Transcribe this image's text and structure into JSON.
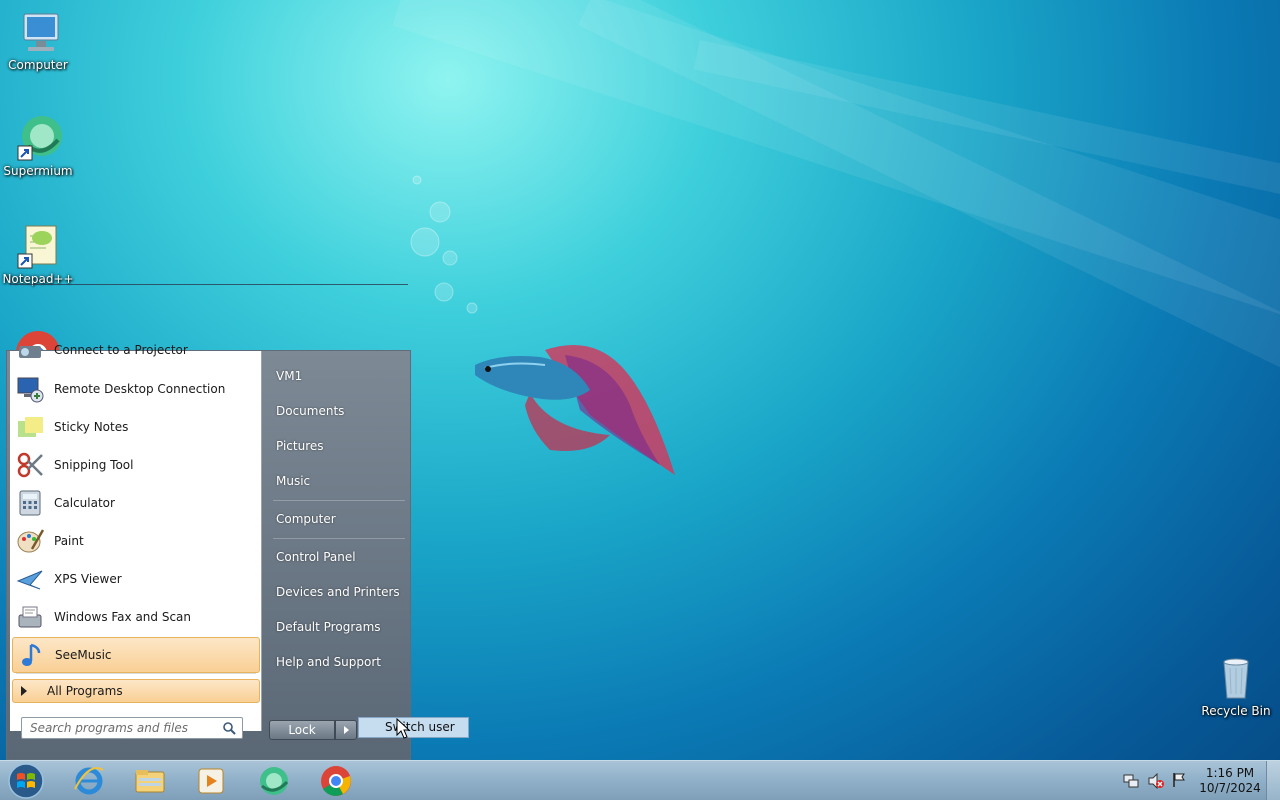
{
  "desktop": {
    "icons": [
      {
        "label": "Computer",
        "icon": "computer-icon"
      },
      {
        "label": "Supermium",
        "icon": "supermium-icon"
      },
      {
        "label": "Notepad++",
        "icon": "notepadplusplus-icon"
      },
      {
        "label": "Recycle Bin",
        "icon": "recycle-bin-icon"
      }
    ]
  },
  "start_menu": {
    "programs": [
      {
        "label": "Connect to a Projector",
        "icon": "projector-icon"
      },
      {
        "label": "Remote Desktop Connection",
        "icon": "remote-desktop-icon"
      },
      {
        "label": "Sticky Notes",
        "icon": "sticky-notes-icon"
      },
      {
        "label": "Snipping Tool",
        "icon": "scissors-icon"
      },
      {
        "label": "Calculator",
        "icon": "calculator-icon"
      },
      {
        "label": "Paint",
        "icon": "paint-palette-icon"
      },
      {
        "label": "XPS Viewer",
        "icon": "xps-viewer-icon"
      },
      {
        "label": "Windows Fax and Scan",
        "icon": "fax-icon"
      },
      {
        "label": "SeeMusic",
        "icon": "music-note-icon"
      }
    ],
    "all_programs": "All Programs",
    "search_placeholder": "Search programs and files",
    "places": [
      "VM1",
      "Documents",
      "Pictures",
      "Music",
      "Computer",
      "Control Panel",
      "Devices and Printers",
      "Default Programs",
      "Help and Support"
    ],
    "lock_label": "Lock",
    "submenu": {
      "switch_user": "Switch user"
    }
  },
  "taskbar": {
    "pinned": [
      {
        "name": "internet-explorer-icon"
      },
      {
        "name": "file-explorer-icon"
      },
      {
        "name": "media-player-icon"
      },
      {
        "name": "supermium-icon"
      },
      {
        "name": "chrome-icon"
      }
    ],
    "clock": {
      "time": "1:16 PM",
      "date": "10/7/2024"
    }
  },
  "colors": {
    "highlight": "#f9cf94",
    "accent": "#0b7bb5"
  }
}
